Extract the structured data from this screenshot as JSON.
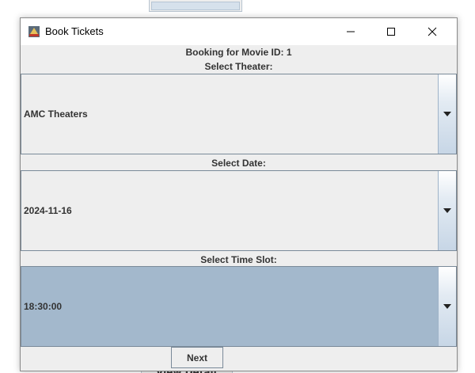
{
  "background": {
    "button_partial_label": "View Detail"
  },
  "window": {
    "title": "Book Tickets",
    "controls": {
      "minimize": "minimize-icon",
      "maximize": "maximize-icon",
      "close": "close-icon"
    }
  },
  "booking": {
    "header": "Booking for Movie ID: 1",
    "theater_label": "Select Theater:",
    "theater_value": "AMC Theaters",
    "date_label": "Select Date:",
    "date_value": "2024-11-16",
    "time_label": "Select Time Slot:",
    "time_value": "18:30:00",
    "next_label": "Next"
  },
  "colors": {
    "window_bg": "#eeeeee",
    "selected_bg": "#a3b8cc",
    "border": "#7a8a99"
  }
}
